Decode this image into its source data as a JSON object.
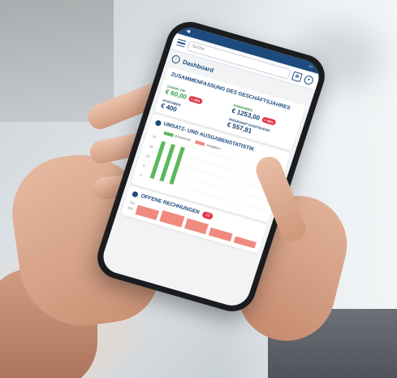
{
  "search": {
    "placeholder": "Suche"
  },
  "page": {
    "title": "Dashboard"
  },
  "summary": {
    "title": "ZUSAMMENFASSUNG DES GESCHÄFTSJAHRES",
    "cashflow_label": "CASHFLOW",
    "cashflow_value": "€ 60,00",
    "cashflow_badge": "+ 40%",
    "income_label": "EINNAHMEN",
    "income_value": "€ 1253,00",
    "income_badge": "+ 40%",
    "expenses_label": "AUSGABEN",
    "expenses_value": "€ 400",
    "outstanding_label": "INSGESAMT AUSSTEHEND",
    "outstanding_value": "€ 557,81"
  },
  "stats": {
    "title": "UMSATZ- UND AUSGABENSTATISTIK",
    "legend_income": "Einnahmen",
    "legend_expenses": "Ausgaben",
    "y_ticks": [
      "20",
      "15",
      "10",
      "5",
      "0"
    ]
  },
  "invoices": {
    "title": "OFFENE RECHNUNGEN",
    "count": "19",
    "y_ticks": [
      "600",
      "500"
    ]
  },
  "colors": {
    "brand": "#1e4b7d",
    "income": "#5cb85c",
    "expenses": "#f08a80",
    "alert": "#e0334a"
  },
  "chart_data": {
    "type": "bar",
    "title": "UMSATZ- UND AUSGABENSTATISTIK",
    "ylim": [
      0,
      20
    ],
    "series": [
      {
        "name": "Einnahmen",
        "values": [
          19,
          19,
          19,
          0,
          0,
          0,
          0,
          0,
          0,
          0,
          0,
          0
        ]
      },
      {
        "name": "Ausgaben",
        "values": [
          0,
          0,
          0,
          0,
          0,
          0,
          0,
          0,
          0,
          0,
          0,
          0
        ]
      }
    ]
  }
}
